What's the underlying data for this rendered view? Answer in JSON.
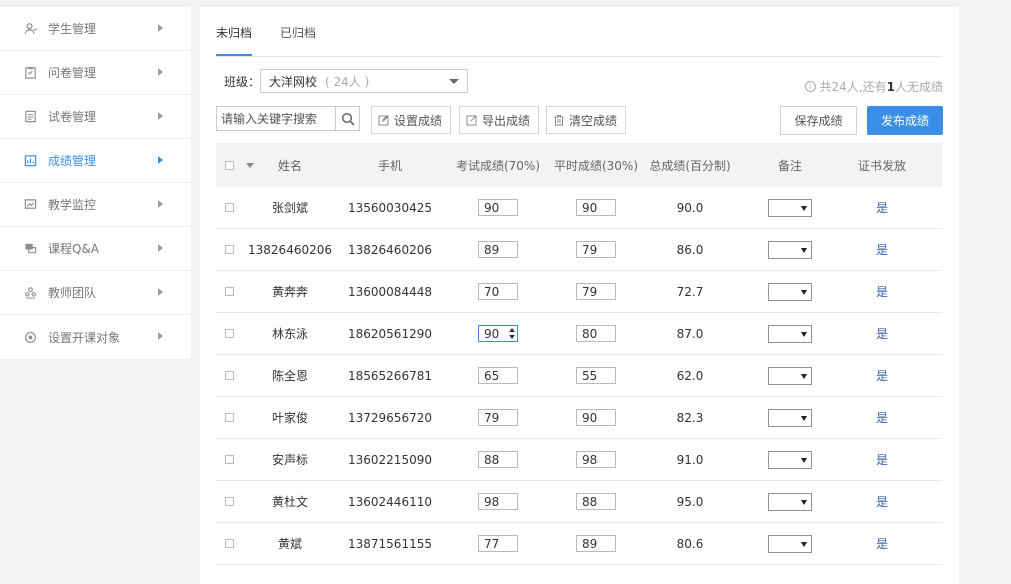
{
  "sidebar": {
    "items": [
      {
        "label": "学生管理",
        "icon": "user-icon"
      },
      {
        "label": "问卷管理",
        "icon": "clipboard-icon"
      },
      {
        "label": "试卷管理",
        "icon": "document-icon"
      },
      {
        "label": "成绩管理",
        "icon": "grades-icon"
      },
      {
        "label": "教学监控",
        "icon": "monitor-chart-icon"
      },
      {
        "label": "课程Q&A",
        "icon": "chat-icon"
      },
      {
        "label": "教师团队",
        "icon": "team-icon"
      },
      {
        "label": "设置开课对象",
        "icon": "target-icon"
      }
    ]
  },
  "tabs": [
    {
      "label": "未归档"
    },
    {
      "label": "已归档"
    }
  ],
  "filter": {
    "class_label": "班级：",
    "class_name": "大洋网校",
    "class_count": "( 24人 )"
  },
  "summary": {
    "prefix": "共24人,还有",
    "count": "1",
    "suffix": "人无成绩"
  },
  "search": {
    "placeholder": "请输入关键字搜索"
  },
  "toolbar": {
    "set_label": "设置成绩",
    "export_label": "导出成绩",
    "clear_label": "清空成绩",
    "save_label": "保存成绩",
    "publish_label": "发布成绩"
  },
  "table": {
    "headers": {
      "name": "姓名",
      "phone": "手机",
      "exam": "考试成绩(70%)",
      "daily": "平时成绩(30%)",
      "total": "总成绩(百分制)",
      "note": "备注",
      "cert": "证书发放"
    },
    "rows": [
      {
        "name": "张剑斌",
        "phone": "13560030425",
        "exam": "90",
        "daily": "90",
        "total": "90.0",
        "cert": "是"
      },
      {
        "name": "13826460206",
        "phone": "13826460206",
        "exam": "89",
        "daily": "79",
        "total": "86.0",
        "cert": "是"
      },
      {
        "name": "黄奔奔",
        "phone": "13600084448",
        "exam": "70",
        "daily": "79",
        "total": "72.7",
        "cert": "是"
      },
      {
        "name": "林东泳",
        "phone": "18620561290",
        "exam": "90",
        "daily": "80",
        "total": "87.0",
        "cert": "是"
      },
      {
        "name": "陈全恩",
        "phone": "18565266781",
        "exam": "65",
        "daily": "55",
        "total": "62.0",
        "cert": "是"
      },
      {
        "name": "叶家俊",
        "phone": "13729656720",
        "exam": "79",
        "daily": "90",
        "total": "82.3",
        "cert": "是"
      },
      {
        "name": "安声标",
        "phone": "13602215090",
        "exam": "88",
        "daily": "98",
        "total": "91.0",
        "cert": "是"
      },
      {
        "name": "黄杜文",
        "phone": "13602446110",
        "exam": "98",
        "daily": "88",
        "total": "95.0",
        "cert": "是"
      },
      {
        "name": "黄斌",
        "phone": "13871561155",
        "exam": "77",
        "daily": "89",
        "total": "80.6",
        "cert": "是"
      }
    ]
  },
  "colors": {
    "accent": "#3a8ee6"
  }
}
